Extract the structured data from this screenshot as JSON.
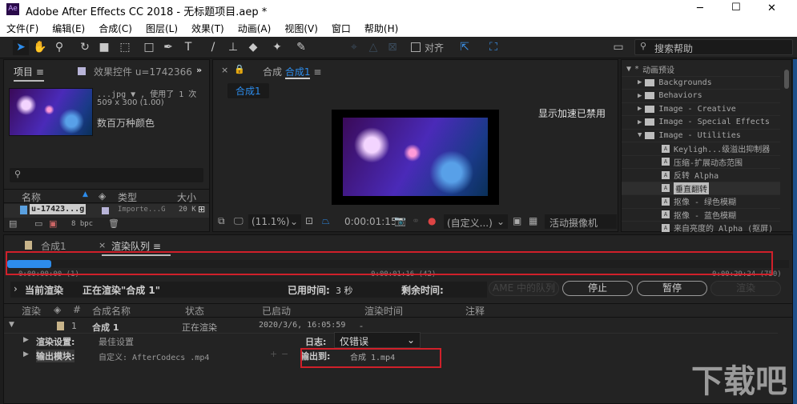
{
  "window": {
    "title": "Adobe After Effects CC 2018 - 无标题项目.aep *",
    "app_icon": "Ae",
    "minimize": "─",
    "maximize": "☐",
    "close": "✕"
  },
  "menu": [
    "文件(F)",
    "编辑(E)",
    "合成(C)",
    "图层(L)",
    "效果(T)",
    "动画(A)",
    "视图(V)",
    "窗口",
    "帮助(H)"
  ],
  "toolbar": {
    "align_label": "对齐",
    "search_placeholder": "搜索帮助"
  },
  "project": {
    "tab_project": "项目",
    "tab_effects": "效果控件 u=1742366",
    "item_name": "...jpg ▼ , 使用了 1 次",
    "item_size": "509 x 300 (1.00)",
    "item_colors": "数百万种颜色",
    "columns": {
      "name": "名称",
      "type": "类型",
      "size": "大小"
    },
    "rows": [
      {
        "name": "u-17423...g",
        "type": "Importe...G",
        "size": "20 K"
      }
    ],
    "bpc": "8 bpc"
  },
  "viewer": {
    "tab_label": "合成",
    "tab_comp": "合成1",
    "breadcrumb": "合成1",
    "gpu_message": "显示加速已禁用",
    "zoom": "(11.1%)",
    "timecode": "0:00:01:15",
    "resolution": "(自定义...)",
    "camera": "活动摄像机"
  },
  "effects": {
    "root": "动画预设",
    "items": [
      {
        "label": "Backgrounds",
        "kind": "folder",
        "open": false
      },
      {
        "label": "Behaviors",
        "kind": "folder",
        "open": false
      },
      {
        "label": "Image - Creative",
        "kind": "folder",
        "open": false
      },
      {
        "label": "Image - Special Effects",
        "kind": "folder",
        "open": false
      },
      {
        "label": "Image - Utilities",
        "kind": "folder",
        "open": true
      },
      {
        "label": "Keyligh...级溢出抑制器",
        "kind": "preset"
      },
      {
        "label": "压缩-扩展动态范围",
        "kind": "preset"
      },
      {
        "label": "反转 Alpha",
        "kind": "preset"
      },
      {
        "label": "垂直翻转",
        "kind": "preset",
        "selected": true
      },
      {
        "label": "抠像 - 绿色模糊",
        "kind": "preset"
      },
      {
        "label": "抠像 - 蓝色模糊",
        "kind": "preset"
      },
      {
        "label": "来自亮度的 Alpha (抠屏)",
        "kind": "preset"
      }
    ]
  },
  "render": {
    "tab_comp": "合成1",
    "tab_queue": "渲染队列",
    "progress": 0.02,
    "time_start": "0:00:00:00 (1)",
    "time_mid": "0:00:01:16 (42)",
    "time_end": "0:00:29:24 (750)",
    "current_label": "当前渲染",
    "rendering": "正在渲染\"合成 1\"",
    "elapsed_label": "已用时间:",
    "elapsed": "3 秒",
    "remaining_label": "剩余时间:",
    "ame_btn": "AME 中的队列",
    "stop_btn": "停止",
    "pause_btn": "暂停",
    "render_btn": "渲染",
    "columns": {
      "render": "渲染",
      "num": "#",
      "comp": "合成名称",
      "status": "状态",
      "started": "已启动",
      "time": "渲染时间",
      "notes": "注释"
    },
    "item": {
      "num": "1",
      "comp": "合成 1",
      "status": "正在渲染",
      "started": "2020/3/6, 16:05:59",
      "time": "-"
    },
    "render_settings_label": "渲染设置:",
    "render_settings": "最佳设置",
    "log_label": "日志:",
    "log_value": "仅错误",
    "output_module_label": "输出模块:",
    "output_module": "自定义: AfterCodecs .mp4",
    "output_to_label": "输出到:",
    "output_to": "合成 1.mp4"
  },
  "watermark": "下载吧"
}
